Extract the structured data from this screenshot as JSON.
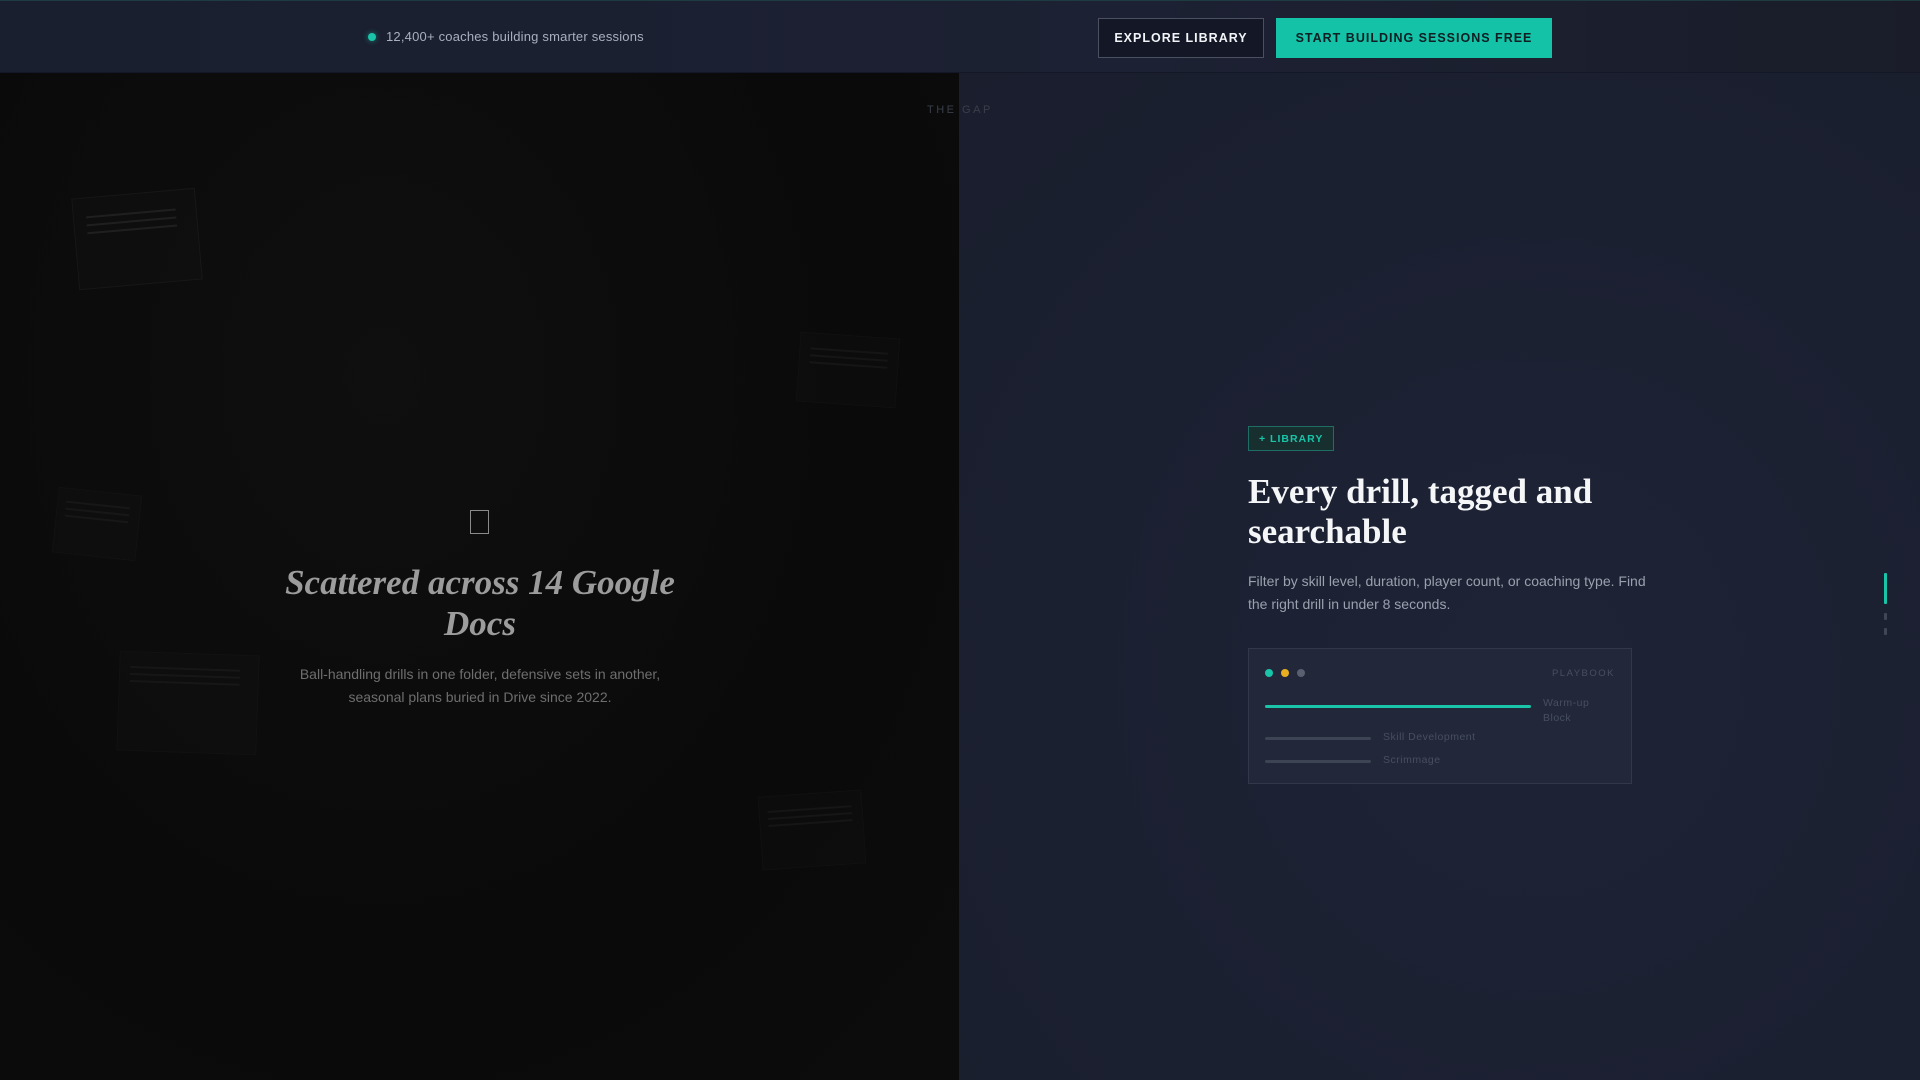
{
  "topbar": {
    "social_proof": "12,400+ coaches building smarter sessions",
    "explore_label": "EXPLORE LIBRARY",
    "cta_label": "START BUILDING SESSIONS FREE"
  },
  "gap_label": "THE GAP",
  "left": {
    "title": "Scattered across 14 Google Docs",
    "description": "Ball-handling drills in one folder, defensive sets in another, seasonal plans buried in Drive since 2022."
  },
  "right": {
    "badge": "+ LIBRARY",
    "title": "Every drill, tagged and searchable",
    "description": "Filter by skill level, duration, player count, or coaching type. Find the right drill in under 8 seconds.",
    "card": {
      "label": "PLAYBOOK",
      "rows": [
        {
          "label": "Warm-up Block",
          "fill": 1.0
        },
        {
          "label": "Skill Development",
          "fill": 0.4
        },
        {
          "label": "Scrimmage",
          "fill": 0.4
        }
      ]
    }
  },
  "colors": {
    "accent": "#19c4a8",
    "dot_yellow": "#e8b021",
    "dot_grey": "#5a6070"
  },
  "icons": {
    "doc": "document-outline-icon"
  }
}
